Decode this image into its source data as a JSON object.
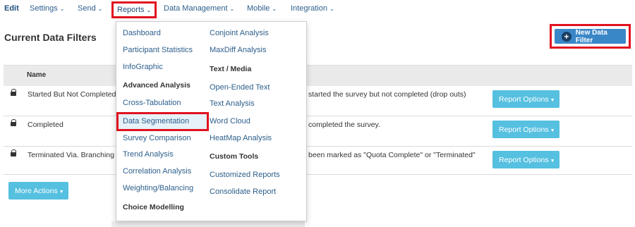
{
  "nav": {
    "edit": "Edit",
    "settings": "Settings",
    "send": "Send",
    "reports": "Reports",
    "data_management": "Data Management",
    "mobile": "Mobile",
    "integration": "Integration",
    "chevron_icon": "chevron-down"
  },
  "page": {
    "title": "Current Data Filters"
  },
  "new_filter_button": "New Data Filter",
  "table": {
    "header_name": "Name",
    "rows": [
      {
        "name": "Started But Not Completed",
        "description": "started the survey but not completed (drop outs)",
        "action": "Report Options"
      },
      {
        "name": "Completed",
        "description": "completed the survey.",
        "action": "Report Options"
      },
      {
        "name": "Terminated Via. Branching",
        "description": "been marked as \"Quota Complete\" or \"Terminated\"",
        "action": "Report Options"
      }
    ]
  },
  "more_actions": "More Actions",
  "reports_menu": {
    "col1": {
      "dashboard": "Dashboard",
      "participant_statistics": "Participant Statistics",
      "infographic": "InfoGraphic",
      "advanced_analysis_heading": "Advanced Analysis",
      "cross_tabulation": "Cross-Tabulation",
      "data_segmentation": "Data Segmentation",
      "survey_comparison": "Survey Comparison",
      "trend_analysis": "Trend Analysis",
      "correlation_analysis": "Correlation Analysis",
      "weighting_balancing": "Weighting/Balancing",
      "choice_modelling_heading": "Choice Modelling"
    },
    "col2": {
      "conjoint_analysis": "Conjoint Analysis",
      "maxdiff_analysis": "MaxDiff Analysis",
      "text_media_heading": "Text / Media",
      "open_ended_text": "Open-Ended Text",
      "text_analysis": "Text Analysis",
      "word_cloud": "Word Cloud",
      "heatmap_analysis": "HeatMap Analysis",
      "custom_tools_heading": "Custom Tools",
      "customized_reports": "Customized Reports",
      "consolidate_report": "Consolidate Report"
    }
  },
  "colors": {
    "link": "#2d5f8c",
    "highlight_border": "#e0121f",
    "primary_button": "#3a87c8",
    "info_button": "#56c0e0",
    "selected_bg": "#e6f1f8"
  }
}
